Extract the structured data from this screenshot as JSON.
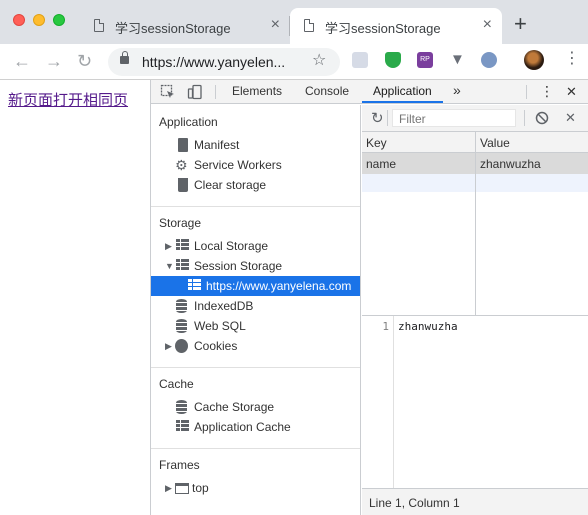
{
  "browser": {
    "tabs": [
      {
        "title": "学习sessionStorage",
        "close": "×",
        "icon": "page-icon"
      },
      {
        "title": "学习sessionStorage",
        "close": "×",
        "icon": "page-icon"
      }
    ],
    "new_tab": "+",
    "nav": {
      "back": "←",
      "forward": "→",
      "reload": "↻"
    },
    "url": "https://www.yanyelen...",
    "star": "☆",
    "menu": "⋮",
    "extensions": [
      "ext-light-icon",
      "shield-check-icon",
      "rp-icon",
      "vimium-icon",
      "circle-ext-icon"
    ],
    "ext_rp_label": "RP"
  },
  "page": {
    "link_text": "新页面打开相同页"
  },
  "devtools": {
    "tabs": [
      "Elements",
      "Console",
      "Application"
    ],
    "active_tab": "Application",
    "more": "»",
    "menu": "⋮",
    "close": "✕",
    "sidebar": {
      "application": {
        "title": "Application",
        "items": [
          "Manifest",
          "Service Workers",
          "Clear storage"
        ]
      },
      "storage": {
        "title": "Storage",
        "items": [
          "Local Storage",
          "Session Storage",
          "https://www.yanyelena.com",
          "IndexedDB",
          "Web SQL",
          "Cookies"
        ]
      },
      "cache": {
        "title": "Cache",
        "items": [
          "Cache Storage",
          "Application Cache"
        ]
      },
      "frames": {
        "title": "Frames",
        "items": [
          "top"
        ]
      },
      "expand_glyph": "▶",
      "collapse_glyph": "▼"
    },
    "storage_view": {
      "filter_placeholder": "Filter",
      "refresh": "↻",
      "clear": "⃠",
      "delete": "✕",
      "columns": [
        "Key",
        "Value"
      ],
      "rows": [
        {
          "key": "name",
          "value": "zhanwuzha"
        }
      ],
      "preview": {
        "line_number": "1",
        "content": "zhanwuzha"
      },
      "status": "Line 1, Column 1"
    }
  }
}
